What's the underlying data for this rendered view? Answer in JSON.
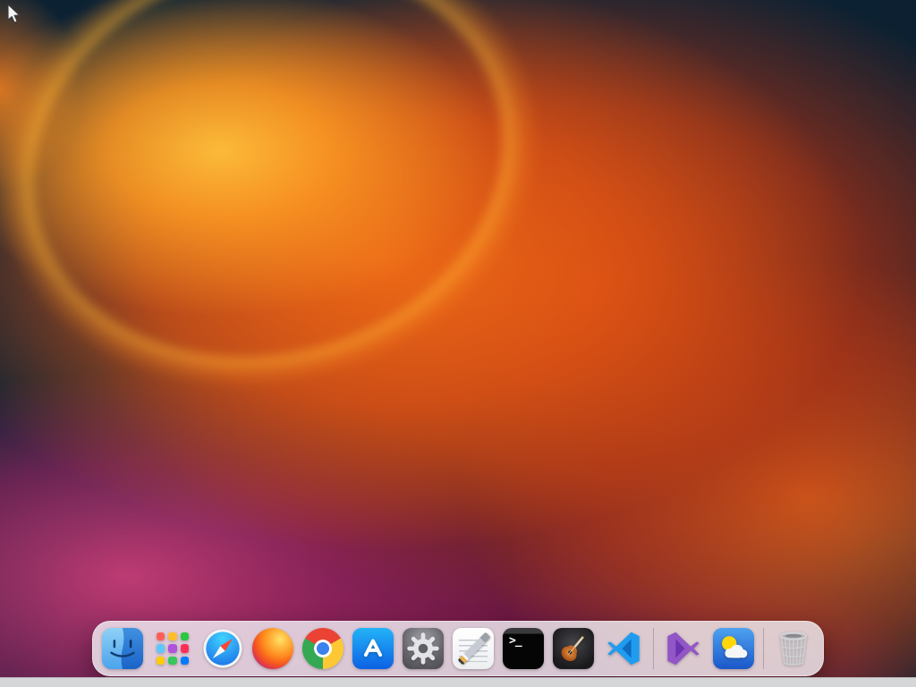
{
  "colors": {
    "wallpaper_base": "#0e2434",
    "wallpaper_orange": "#ee6a16",
    "wallpaper_bright_orange": "#ffb224",
    "wallpaper_magenta": "#ce3e7a",
    "wallpaper_maroon": "#77204b",
    "dock_background": "#f3f3f7",
    "dock_separator": "#9a9aa0",
    "bottom_edge": "#d5d6d8"
  },
  "cursor": {
    "shape": "arrow"
  },
  "dock": {
    "items": [
      {
        "id": "finder",
        "label": "Finder"
      },
      {
        "id": "launchpad",
        "label": "Launchpad"
      },
      {
        "id": "safari",
        "label": "Safari"
      },
      {
        "id": "firefox",
        "label": "Firefox"
      },
      {
        "id": "chrome",
        "label": "Google Chrome"
      },
      {
        "id": "app-store",
        "label": "App Store"
      },
      {
        "id": "system-settings",
        "label": "System Settings"
      },
      {
        "id": "textedit",
        "label": "TextEdit"
      },
      {
        "id": "terminal",
        "label": "Terminal"
      },
      {
        "id": "garageband",
        "label": "GarageBand"
      },
      {
        "id": "vscode",
        "label": "Visual Studio Code"
      },
      {
        "id": "visual-studio",
        "label": "Visual Studio"
      },
      {
        "id": "weather",
        "label": "Weather"
      },
      {
        "id": "trash",
        "label": "Trash"
      }
    ],
    "separators": 2,
    "terminal_glyph": ">_",
    "launchpad_dot_colors": [
      "#ff5f57",
      "#ffbd2e",
      "#28c840",
      "#5ac8fa",
      "#af52de",
      "#ff2d55",
      "#ffcc00",
      "#34c759",
      "#007aff"
    ]
  }
}
